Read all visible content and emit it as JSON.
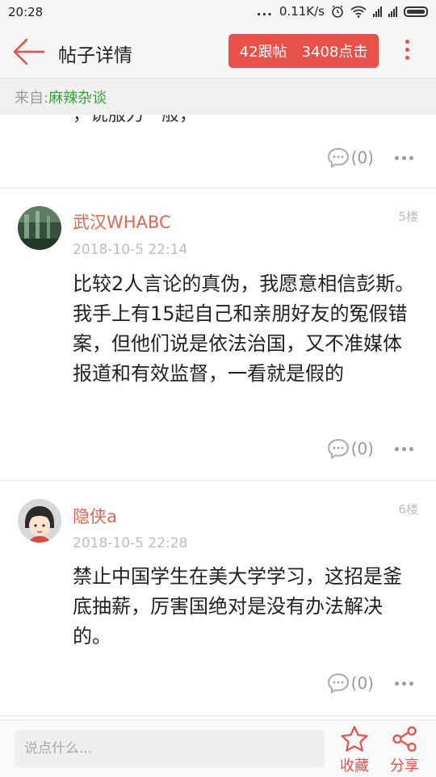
{
  "status_bar": {
    "time": "20:28",
    "dots": "...",
    "network_speed": "0.11K/s"
  },
  "header": {
    "title": "帖子详情",
    "reply_count": "42跟帖",
    "click_count": "3408点击"
  },
  "source": {
    "prefix": "来自:",
    "name": "麻辣杂谈"
  },
  "previous_post": {
    "fragment": "，说服力一般，",
    "comment_count": "(0)"
  },
  "posts": [
    {
      "author": "武汉WHABC",
      "floor": "5楼",
      "date": "2018-10-5 22:14",
      "text": "比较2人言论的真伪，我愿意相信彭斯。我手上有15起自己和亲朋好友的冤假错案，但他们说是依法治国，又不准媒体报道和有效监督，一看就是假的",
      "comment_count": "(0)"
    },
    {
      "author": "隐侠a",
      "floor": "6楼",
      "date": "2018-10-5 22:28",
      "text": "禁止中国学生在美大学学习，这招是釜底抽薪，厉害国绝对是没有办法解决的。",
      "comment_count": "(0)"
    }
  ],
  "bottom_bar": {
    "input_placeholder": "说点什么...",
    "favorite_label": "收藏",
    "share_label": "分享"
  },
  "colors": {
    "accent": "#e8504a",
    "author": "#e06650",
    "source_green": "#3aa142"
  },
  "icons": [
    "back-arrow-icon",
    "more-vertical-icon",
    "comment-bubble-icon",
    "more-horizontal-icon",
    "star-icon",
    "share-icon",
    "wifi-icon",
    "alarm-icon",
    "signal-icon",
    "battery-icon"
  ]
}
